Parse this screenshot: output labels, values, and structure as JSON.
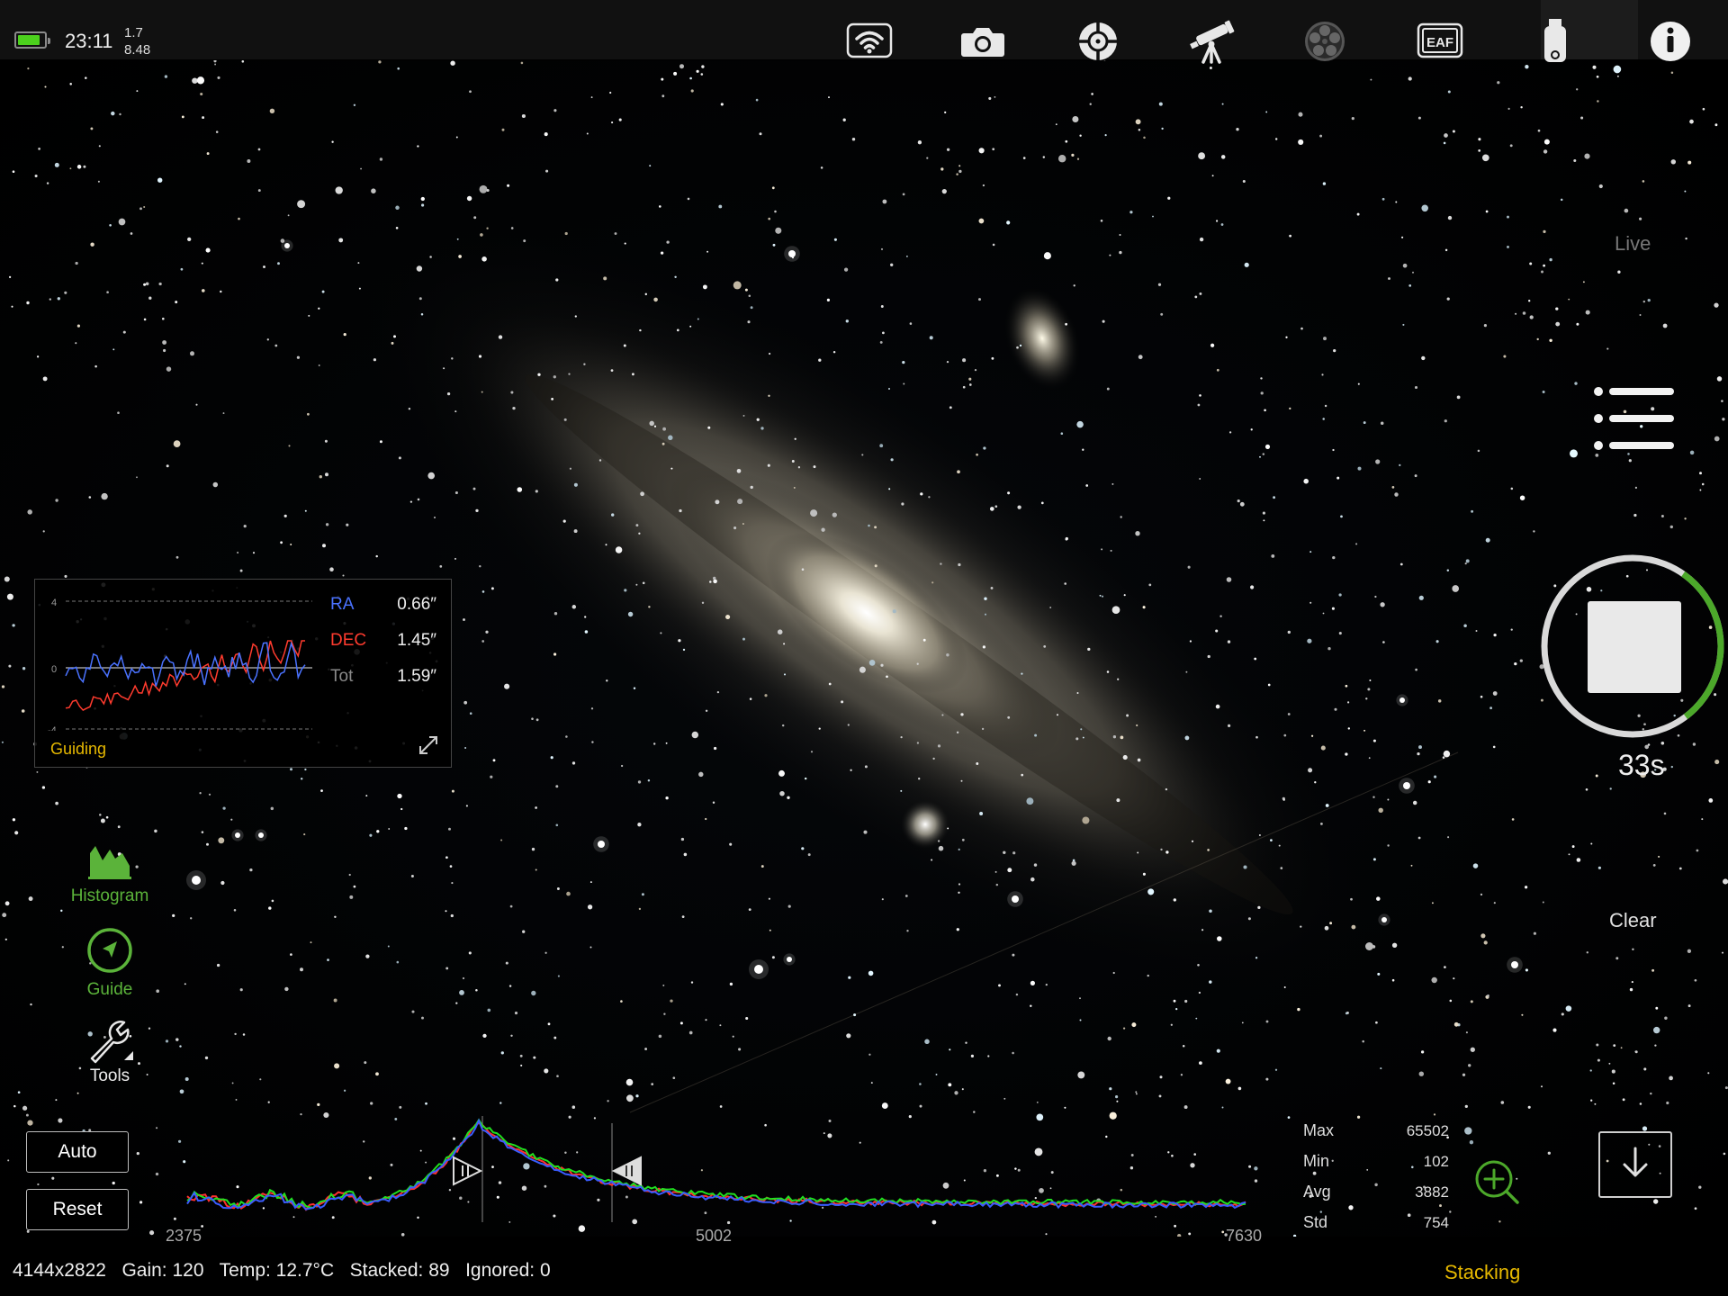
{
  "topbar": {
    "battery_level": 0.85,
    "time": "23:11",
    "mini_top": "1.7",
    "mini_bottom": "8.48",
    "icons": [
      "wifi-icon",
      "camera-icon",
      "guide-scope-icon",
      "telescope-icon",
      "filter-wheel-icon",
      "eaf-icon",
      "usb-drive-icon",
      "info-icon"
    ],
    "eaf_label": "EAF",
    "colors": {
      "battery": "#4cd11d"
    }
  },
  "right_panel": {
    "live_label": "Live",
    "menu_icon": "list-menu-icon",
    "capture_progress": 0.3,
    "timer": "33s",
    "clear_label": "Clear",
    "download_icon": "download-icon",
    "colors": {
      "progress": "#4ca82a",
      "ring": "#d9d9d9"
    }
  },
  "guiding": {
    "title": "Guiding",
    "axis_labels": [
      "4",
      "0",
      "-4"
    ],
    "rows": [
      {
        "name": "RA",
        "value": "0.66″",
        "color": "#4a72ff"
      },
      {
        "name": "DEC",
        "value": "1.45″",
        "color": "#ff3b2e"
      },
      {
        "name": "Tot",
        "value": "1.59″",
        "color": "#8a8a8a"
      }
    ],
    "expand_icon": "expand-icon"
  },
  "tools": {
    "histogram_label": "Histogram",
    "guide_label": "Guide",
    "tools_label": "Tools",
    "accent": "#5bb33a"
  },
  "histogram": {
    "auto_label": "Auto",
    "reset_label": "Reset",
    "tick_left": "2375",
    "tick_mid": "5002",
    "tick_right": "7630",
    "stats": [
      {
        "label": "Max",
        "value": "65502"
      },
      {
        "label": "Min",
        "value": "102"
      },
      {
        "label": "Avg",
        "value": "3882"
      },
      {
        "label": "Std",
        "value": "754"
      }
    ],
    "zoom_icon": "zoom-in-icon"
  },
  "status": {
    "resolution": "4144x2822",
    "gain": "Gain: 120",
    "temp": "Temp: 12.7°C",
    "stacked": "Stacked: 89",
    "ignored": "Ignored: 0",
    "mode": "Stacking"
  }
}
